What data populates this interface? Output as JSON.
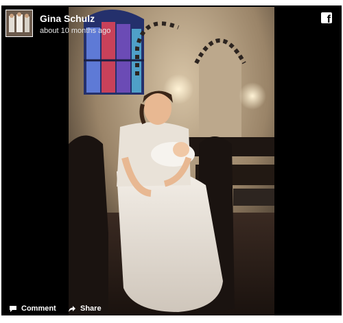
{
  "post": {
    "author": "Gina Schulz",
    "timestamp": "about 10 months ago"
  },
  "actions": {
    "comment_label": "Comment",
    "share_label": "Share"
  },
  "icons": {
    "platform": "facebook-icon",
    "comment": "speech-bubble-icon",
    "share": "share-arrow-icon"
  },
  "colors": {
    "card_background": "#000000",
    "text": "#ffffff"
  }
}
